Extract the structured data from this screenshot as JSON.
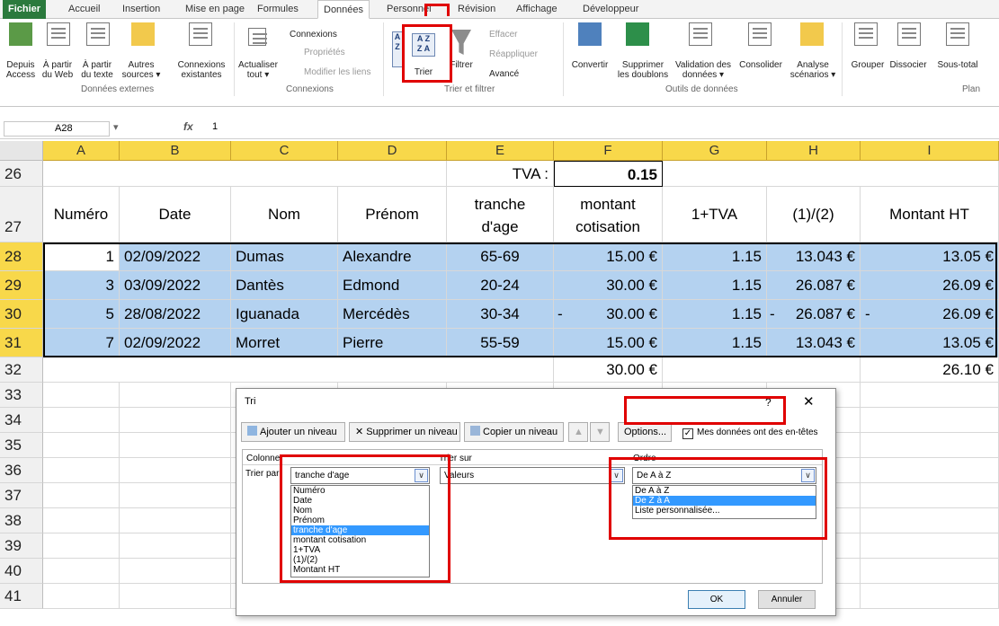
{
  "ribbon_tabs": [
    "Fichier",
    "Accueil",
    "Insertion",
    "Mise en page",
    "Formules",
    "Données",
    "Personnel",
    "Révision",
    "Affichage",
    "Développeur"
  ],
  "ribbon": {
    "btn_access": [
      "Depuis",
      "Access"
    ],
    "btn_web": [
      "À partir",
      "du Web"
    ],
    "btn_text": [
      "À partir",
      "du texte"
    ],
    "btn_other": [
      "Autres",
      "sources ▾"
    ],
    "btn_existing": [
      "Connexions",
      "existantes"
    ],
    "grp_external": "Données externes",
    "btn_refresh": [
      "Actualiser",
      "tout ▾"
    ],
    "link_connexions": "Connexions",
    "link_props": "Propriétés",
    "link_edit": "Modifier les liens",
    "grp_connexions": "Connexions",
    "btn_sort": "Trier",
    "btn_filter": "Filtrer",
    "link_clear": "Effacer",
    "link_reapply": "Réappliquer",
    "link_advanced": "Avancé",
    "grp_sortfilter": "Trier et filtrer",
    "btn_convert": "Convertir",
    "btn_dupes": [
      "Supprimer",
      "les doublons"
    ],
    "btn_validation": [
      "Validation des",
      "données ▾"
    ],
    "btn_consolidate": "Consolider",
    "btn_analysis": [
      "Analyse",
      "scénarios ▾"
    ],
    "grp_tools": "Outils de données",
    "btn_group": "Grouper",
    "btn_ungroup": "Dissocier",
    "btn_subtotal": "Sous-total",
    "grp_plan": "Plan"
  },
  "formula_bar": {
    "name": "A28",
    "fx": "fx",
    "value": "1"
  },
  "columns": [
    "A",
    "B",
    "C",
    "D",
    "E",
    "F",
    "G",
    "H",
    "I"
  ],
  "rows": {
    "r26": {
      "num": "26",
      "e": "TVA :",
      "f": "0.15"
    },
    "r27": {
      "num": "27",
      "a": "Numéro",
      "b": "Date",
      "c": "Nom",
      "d": "Prénom",
      "e1": "tranche",
      "e2": "d'age",
      "f1": "montant",
      "f2": "cotisation",
      "g": "1+TVA",
      "h": "(1)/(2)",
      "i": "Montant HT"
    },
    "data": [
      {
        "num": "28",
        "a": "1",
        "b": "02/09/2022",
        "c": "Dumas",
        "d": "Alexandre",
        "e": "65-69",
        "f": "15.00 €",
        "g": "1.15",
        "h": "13.043 €",
        "i": "13.05 €"
      },
      {
        "num": "29",
        "a": "3",
        "b": "03/09/2022",
        "c": "Dantès",
        "d": "Edmond",
        "e": "20-24",
        "f": "30.00 €",
        "g": "1.15",
        "h": "26.087 €",
        "i": "26.09 €"
      },
      {
        "num": "30",
        "a": "5",
        "b": "28/08/2022",
        "c": "Iguanada",
        "d": "Mercédès",
        "e": "30-34",
        "f": "30.00 €",
        "g": "1.15",
        "h": "26.087 €",
        "i": "26.09 €"
      },
      {
        "num": "31",
        "a": "7",
        "b": "02/09/2022",
        "c": "Morret",
        "d": "Pierre",
        "e": "55-59",
        "f": "15.00 €",
        "g": "1.15",
        "h": "13.043 €",
        "i": "13.05 €"
      }
    ],
    "r32": {
      "num": "32",
      "f": "30.00 €",
      "i": "26.10 €"
    },
    "empty": [
      "33",
      "34",
      "35",
      "36",
      "37",
      "38",
      "39",
      "40",
      "41"
    ]
  },
  "dialog": {
    "title": "Tri",
    "help": "?",
    "close": "✕",
    "add_level": "Ajouter un niveau",
    "delete_level": "Supprimer un niveau",
    "copy_level": "Copier un niveau",
    "options": "Options...",
    "headers_label": "Mes données ont des en-têtes",
    "col_header": "Colonne",
    "sorton_header": "Trier sur",
    "order_header": "Ordre",
    "sortby_label": "Trier par",
    "column_value": "tranche d'age",
    "sorton_value": "Valeurs",
    "order_value": "De A à Z",
    "column_options": [
      "Numéro",
      "Date",
      "Nom",
      "Prénom",
      "tranche d'age",
      "montant cotisation",
      "1+TVA",
      "(1)/(2)",
      "Montant HT"
    ],
    "column_selected": "tranche d'age",
    "order_options": [
      "De A à Z",
      "De Z à A",
      "Liste personnalisée..."
    ],
    "order_selected": "De Z à A",
    "ok": "OK",
    "cancel": "Annuler"
  }
}
